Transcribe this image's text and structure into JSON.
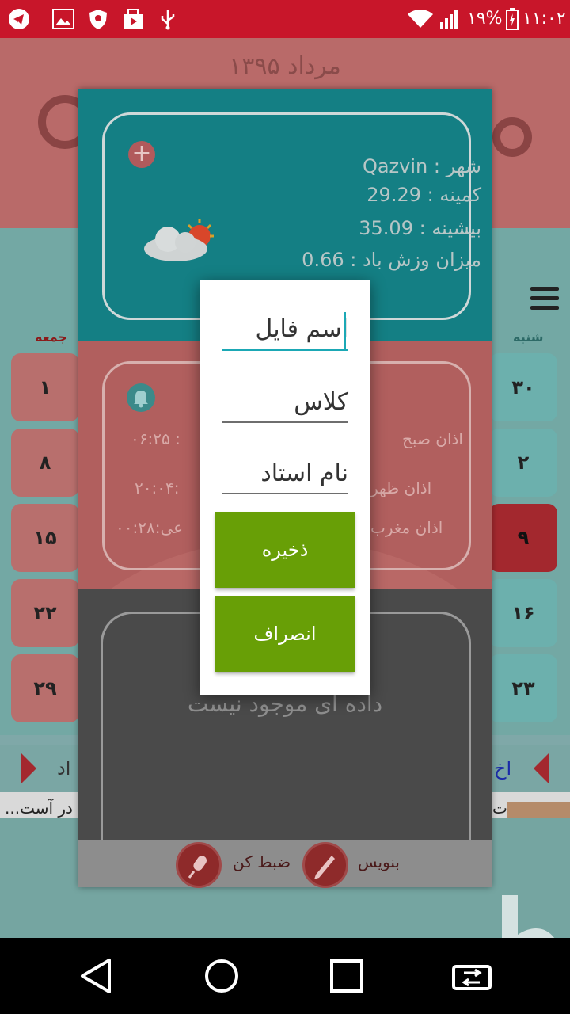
{
  "status_bar": {
    "battery_percent": "۱۹%",
    "time": "۱۱:۰۲",
    "icons": [
      "telegram-icon",
      "image-icon",
      "vpn-shield-icon",
      "media-icon",
      "usb-icon",
      "wifi-icon",
      "signal-icon",
      "battery-icon"
    ]
  },
  "calendar": {
    "month_title": "مرداد ۱۳۹۵",
    "day_header_right": "شنبه",
    "day_header_left": "جمعه",
    "left_column": [
      "۱",
      "۸",
      "۱۵",
      "۲۲",
      "۲۹"
    ],
    "right_column": [
      "۳۰",
      "۲",
      "۹",
      "۱۶",
      "۲۳"
    ]
  },
  "news": {
    "left_text": "اد",
    "right_text": "اخ",
    "strip_left": "در آست...",
    "strip_right": "ت"
  },
  "weather": {
    "city": "شهر : Qazvin",
    "min": "کمینه : 29.29",
    "max": "بیشینه : 35.09",
    "wind": "میزان وزش باد : 0.66"
  },
  "prayer": {
    "fajr_label": "اذان صبح",
    "fajr_time": "۰۶:۲۵ :",
    "dhuhr_label": "اذان ظهر",
    "dhuhr_time": "۲۰:۰۴:",
    "maghrib_label": "اذان مغرب",
    "maghrib_time": "۰۰:۲۸:عی"
  },
  "notes": {
    "empty_text": "داده ای موجود نیست",
    "write_label": "بنویس",
    "record_label": "ضبط کن"
  },
  "modal": {
    "file_name_placeholder": "اسم فایل",
    "class_placeholder": "کلاس",
    "teacher_placeholder": "نام استاد",
    "save_label": "ذخیره",
    "cancel_label": "انصراف"
  },
  "colors": {
    "status_bar": "#c8162a",
    "accent_teal": "#1ba8b5",
    "button_green": "#689f06"
  }
}
